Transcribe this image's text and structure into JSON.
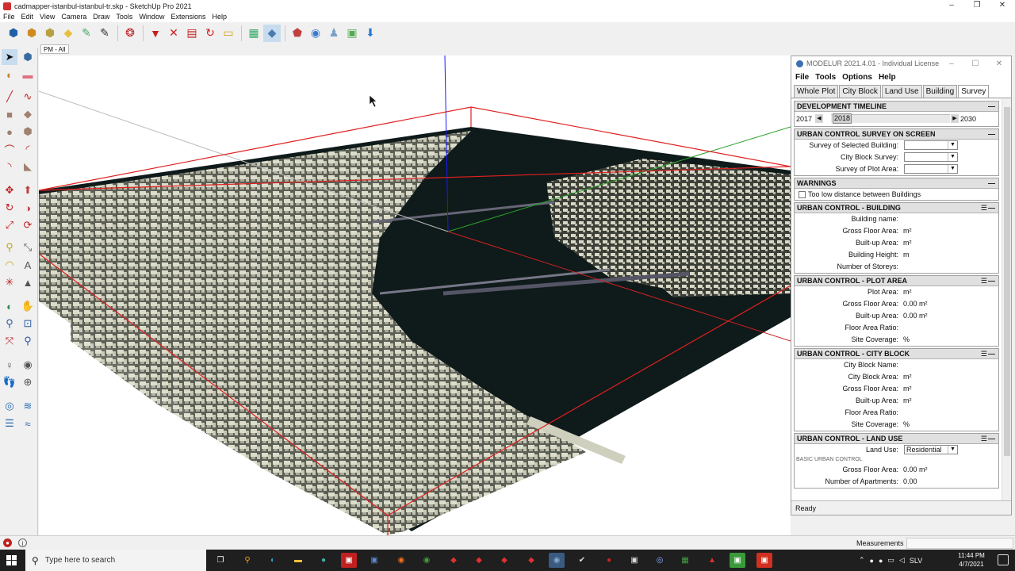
{
  "window": {
    "title": "cadmapper-istanbul-istanbul-tr.skp - SketchUp Pro 2021",
    "minimize": "–",
    "maximize": "❐",
    "close": "✕"
  },
  "menu": [
    "File",
    "Edit",
    "View",
    "Camera",
    "Draw",
    "Tools",
    "Window",
    "Extensions",
    "Help"
  ],
  "scene_tab": "PM - All",
  "modelur": {
    "title": "MODELUR 2021.4.01 - Individual License",
    "menu": [
      "File",
      "Tools",
      "Options",
      "Help"
    ],
    "tabs": [
      "Whole Plot",
      "City Block",
      "Land Use",
      "Building",
      "Survey"
    ],
    "active_tab": "Survey",
    "timeline": {
      "header": "DEVELOPMENT TIMELINE",
      "start": "2017",
      "current": "2018",
      "end": "2030"
    },
    "survey": {
      "header": "URBAN CONTROL SURVEY ON SCREEN",
      "rows": [
        "Survey of Selected Building:",
        "City Block Survey:",
        "Survey of Plot Area:"
      ]
    },
    "warnings": {
      "header": "WARNINGS",
      "item": "Too low distance between Buildings"
    },
    "building": {
      "header": "URBAN CONTROL - BUILDING",
      "rows": [
        {
          "label": "Building name:",
          "value": ""
        },
        {
          "label": "Gross Floor Area:",
          "value": "m²"
        },
        {
          "label": "Built-up Area:",
          "value": "m²"
        },
        {
          "label": "Building Height:",
          "value": "m"
        },
        {
          "label": "Number of Storeys:",
          "value": ""
        }
      ]
    },
    "plot": {
      "header": "URBAN CONTROL - PLOT AREA",
      "rows": [
        {
          "label": "Plot Area:",
          "value": "m²"
        },
        {
          "label": "Gross Floor Area:",
          "value": "0.00 m²"
        },
        {
          "label": "Built-up Area:",
          "value": "0.00 m²"
        },
        {
          "label": "Floor Area Ratio:",
          "value": ""
        },
        {
          "label": "Site Coverage:",
          "value": "%"
        }
      ]
    },
    "city_block": {
      "header": "URBAN CONTROL - CITY BLOCK",
      "rows": [
        {
          "label": "City Block Name:",
          "value": ""
        },
        {
          "label": "City Block Area:",
          "value": "m²"
        },
        {
          "label": "Gross Floor Area:",
          "value": "m²"
        },
        {
          "label": "Built-up Area:",
          "value": "m²"
        },
        {
          "label": "Floor Area Ratio:",
          "value": ""
        },
        {
          "label": "Site Coverage:",
          "value": "%"
        }
      ]
    },
    "land_use": {
      "header": "URBAN CONTROL - LAND USE",
      "label": "Land Use:",
      "value": "Residential",
      "subheader": "BASIC URBAN CONTROL",
      "rows": [
        {
          "label": "Gross Floor Area:",
          "value": "0.00 m²"
        },
        {
          "label": "Number of Apartments:",
          "value": "0.00"
        }
      ]
    },
    "status": "Ready"
  },
  "statusbar": {
    "measurements": "Measurements"
  },
  "taskbar": {
    "search_placeholder": "Type here to search",
    "lang": "SLV",
    "time": "11:44 PM",
    "date": "4/7/2021"
  },
  "colors": {
    "water": "#0f1a1a",
    "building": "#dcdccb",
    "boundary": "#e02020",
    "taskbar": "#1f1f1f"
  }
}
